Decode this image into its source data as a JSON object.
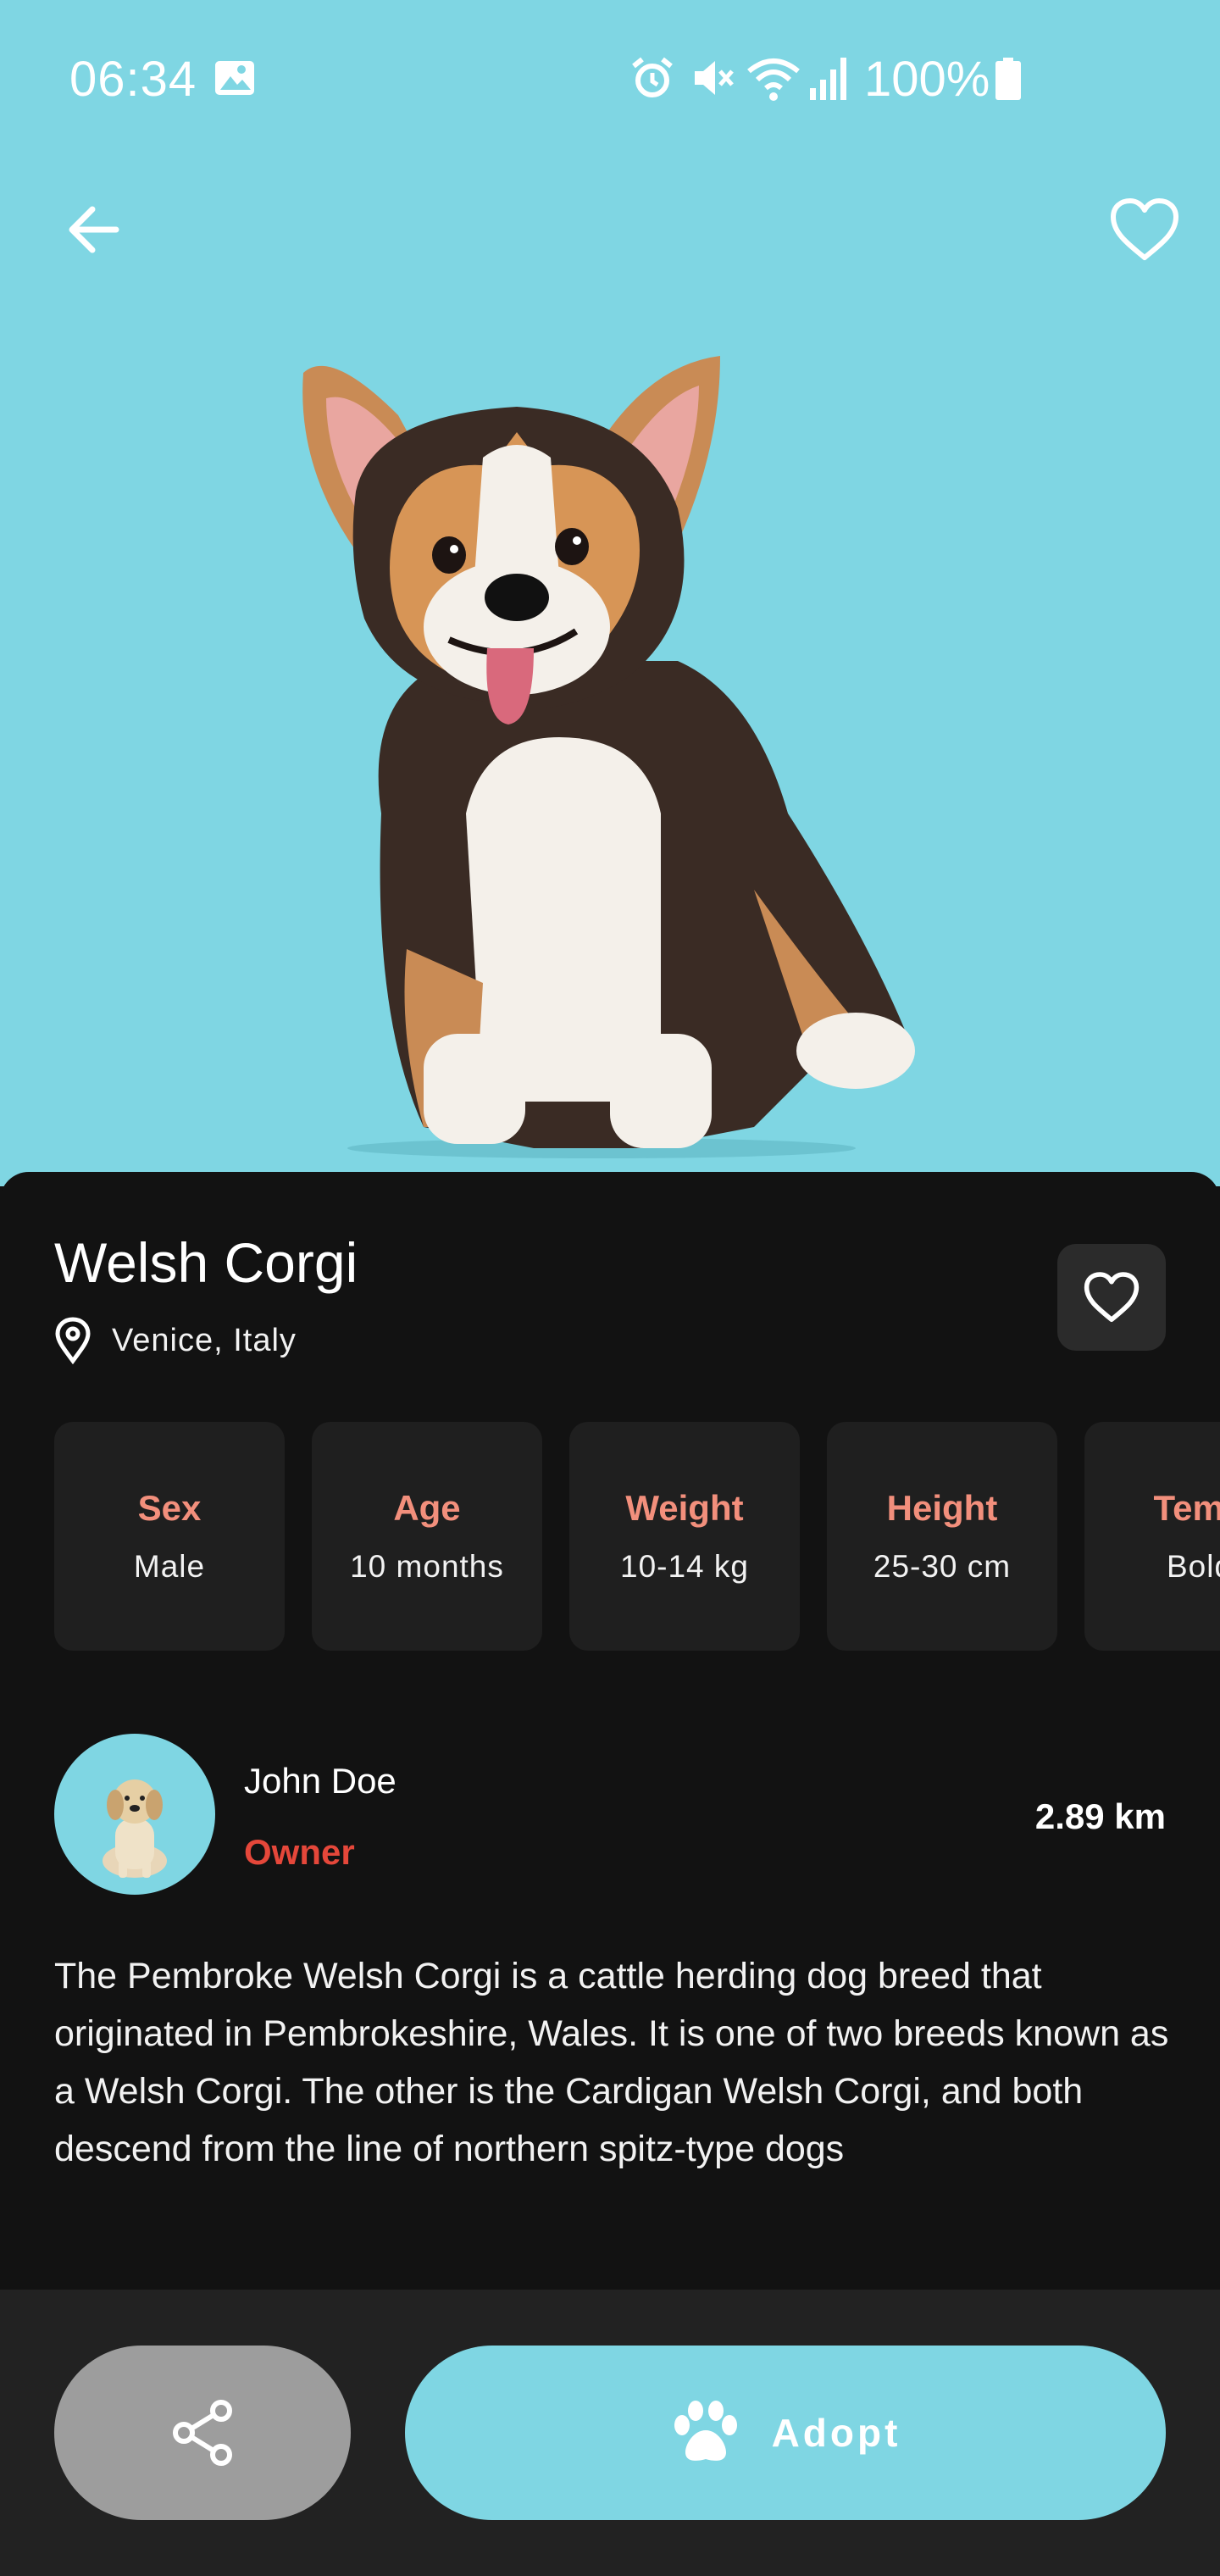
{
  "status_bar": {
    "time": "06:34",
    "battery": "100%",
    "icons": [
      "image-icon",
      "alarm-icon",
      "mute-icon",
      "wifi-icon",
      "signal-icon",
      "battery-icon"
    ]
  },
  "toolbar": {
    "back_icon": "arrow-left-icon",
    "favorite_icon": "heart-outline-icon"
  },
  "pet": {
    "name": "Welsh Corgi",
    "location": "Venice, Italy",
    "attributes": [
      {
        "key": "Sex",
        "value": "Male"
      },
      {
        "key": "Age",
        "value": "10 months"
      },
      {
        "key": "Weight",
        "value": "10-14 kg"
      },
      {
        "key": "Height",
        "value": "25-30 cm"
      },
      {
        "key": "Temp",
        "value": "Bold"
      }
    ],
    "description": "The Pembroke Welsh Corgi is a cattle herding dog breed that originated in Pembrokeshire, Wales. It is one of two breeds known as a Welsh Corgi. The other is the Cardigan Welsh Corgi, and both descend from the line of northern spitz-type dogs"
  },
  "owner": {
    "name": "John Doe",
    "role": "Owner",
    "distance": "2.89 km"
  },
  "actions": {
    "share_icon": "share-icon",
    "adopt_icon": "paw-icon",
    "adopt_label": "Adopt"
  },
  "colors": {
    "hero_bg": "#7fd6e3",
    "accent": "#f28f7c",
    "owner_role": "#e5473a",
    "sheet_bg": "#121212",
    "card_bg": "#1f1f1f"
  }
}
